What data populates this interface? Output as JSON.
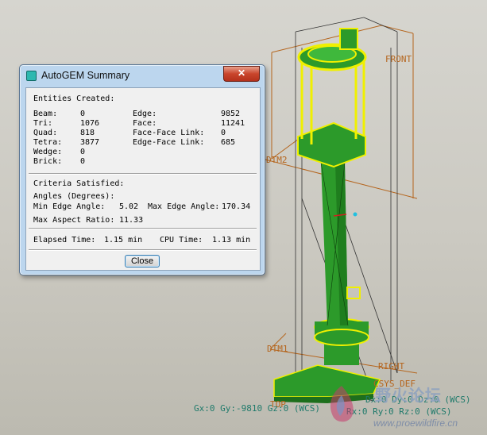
{
  "dialog": {
    "title": "AutoGEM Summary",
    "close_glyph": "✕",
    "entities": {
      "heading": "Entities Created:",
      "left": [
        {
          "label": "Beam:",
          "value": "0"
        },
        {
          "label": "Tri:",
          "value": "1076"
        },
        {
          "label": "Quad:",
          "value": "818"
        },
        {
          "label": "Tetra:",
          "value": "3877"
        },
        {
          "label": "Wedge:",
          "value": "0"
        },
        {
          "label": "Brick:",
          "value": "0"
        }
      ],
      "right": [
        {
          "label": "Edge:",
          "value": "9852"
        },
        {
          "label": "Face:",
          "value": "11241"
        },
        {
          "label": "Face-Face Link:",
          "value": "0"
        },
        {
          "label": "Edge-Face Link:",
          "value": "685"
        }
      ]
    },
    "criteria": {
      "heading": "Criteria Satisfied:",
      "angles_heading": "Angles (Degrees):",
      "min_edge_label": "Min Edge Angle:",
      "min_edge_value": "5.02",
      "max_edge_label": "Max Edge Angle:",
      "max_edge_value": "170.34",
      "aspect_label": "Max Aspect Ratio:",
      "aspect_value": "11.33"
    },
    "timing": {
      "elapsed_label": "Elapsed Time:",
      "elapsed_value": "1.15 min",
      "cpu_label": "CPU Time:",
      "cpu_value": "1.13 min"
    },
    "close_button": "Close"
  },
  "viewport": {
    "datum_labels": {
      "front": "FRONT",
      "dtm2": "DTM2",
      "dtm1": "DTM1",
      "right": "RIGHT",
      "top": "TOP",
      "csys": "CSYS_DEF"
    },
    "status": {
      "gravity": "Gx:0 Gy:-9810 Gz:0 (WCS)",
      "rot": "Rx:0 Ry:0 Rz:0 (WCS)",
      "disp": "Dx:0 Dy:0 Dz:0 (WCS)"
    }
  },
  "watermark": {
    "text": "野火论坛",
    "url": "www.proewildfire.cn"
  },
  "colors": {
    "mesh_green": "#2c9a2a",
    "mesh_yellow": "#f0f000",
    "datum_orange": "#b5651d",
    "status_teal": "#1f7a6b"
  }
}
